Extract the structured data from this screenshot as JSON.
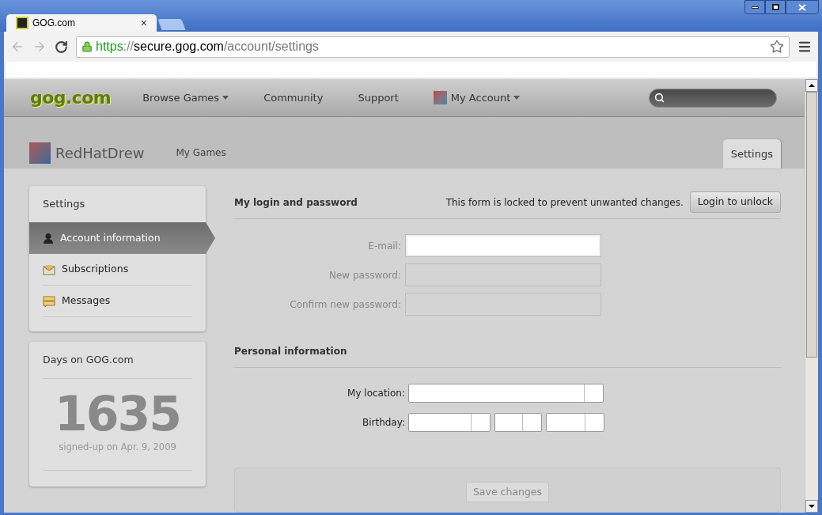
{
  "browser": {
    "tab_title": "GOG.com",
    "tab_close": "×",
    "url": {
      "scheme": "https",
      "separator": "://",
      "host": "secure.gog.com",
      "path": "/account/settings"
    }
  },
  "site_nav": {
    "logo": "gog.com",
    "items": [
      {
        "label": "Browse Games",
        "dropdown": true
      },
      {
        "label": "Community",
        "dropdown": false
      },
      {
        "label": "Support",
        "dropdown": false
      },
      {
        "label": "My Account",
        "dropdown": true
      }
    ]
  },
  "profile": {
    "username": "RedHatDrew",
    "tabs": [
      {
        "label": "My Games",
        "selected": false
      }
    ],
    "right_tab": {
      "label": "Settings",
      "selected": true
    }
  },
  "sidebar": {
    "title": "Settings",
    "items": [
      {
        "label": "Account information",
        "selected": true
      },
      {
        "label": "Subscriptions",
        "selected": false
      },
      {
        "label": "Messages",
        "selected": false
      }
    ]
  },
  "days_card": {
    "title": "Days on GOG.com",
    "count": "1635",
    "caption": "signed-up on Apr. 9, 2009"
  },
  "login_section": {
    "title": "My login and password",
    "lock_notice": "This form is locked to prevent unwanted changes.",
    "unlock_button": "Login to unlock",
    "fields": [
      {
        "label": "E-mail:",
        "disabled": false
      },
      {
        "label": "New password:",
        "disabled": true
      },
      {
        "label": "Confirm new password:",
        "disabled": true
      }
    ]
  },
  "personal_section": {
    "title": "Personal information",
    "fields": [
      {
        "label": "My location:",
        "kind": "select"
      },
      {
        "label": "Birthday:",
        "kind": "date"
      }
    ]
  },
  "save_button": "Save changes"
}
